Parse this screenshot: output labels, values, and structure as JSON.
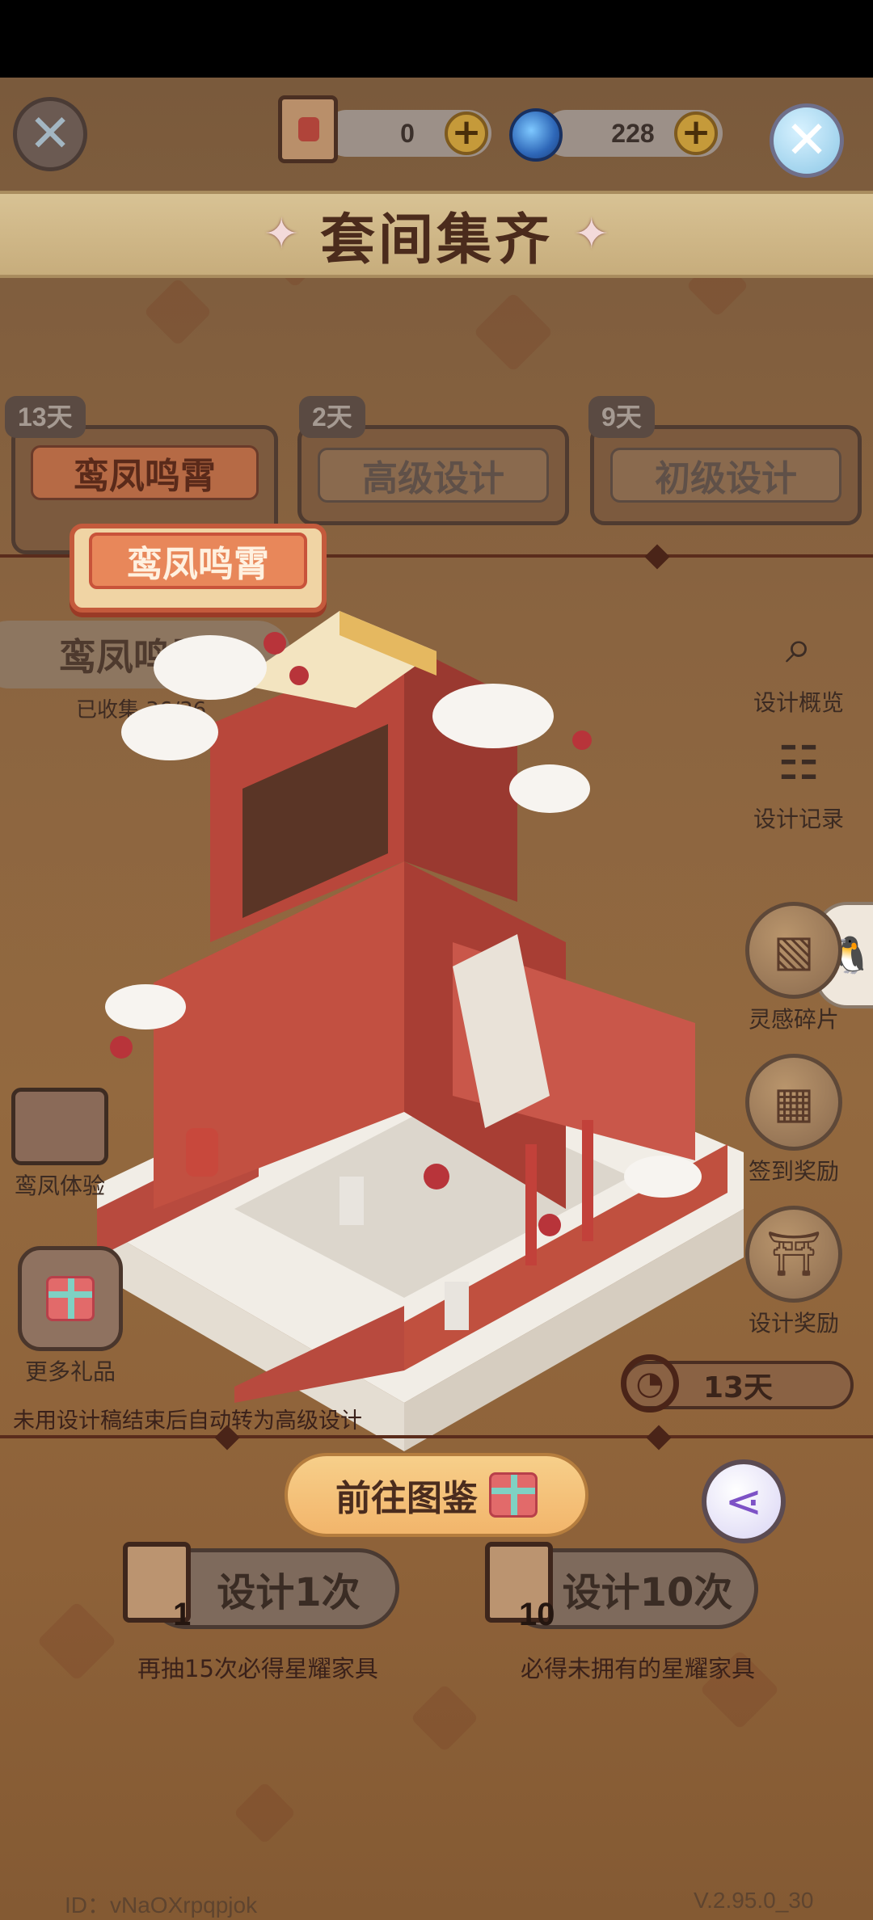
{
  "header": {
    "scroll_count": "0",
    "orb_count": "228",
    "banner_title": "套间集齐"
  },
  "tabs": [
    {
      "days": "13天",
      "label": "鸾凤鸣霄",
      "active": true
    },
    {
      "days": "2天",
      "label": "高级设计",
      "active": false
    },
    {
      "days": "9天",
      "label": "初级设计",
      "active": false
    }
  ],
  "set": {
    "card_label": "鸾凤鸣霄",
    "name": "鸾凤鸣霄",
    "collected": "已收集 36/36"
  },
  "side_menu": [
    {
      "label": "设计概览",
      "icon": "magnifier-icon"
    },
    {
      "label": "设计记录",
      "icon": "clipboard-icon"
    },
    {
      "label": "灵感碎片",
      "icon": "map-fragment-icon"
    },
    {
      "label": "签到奖励",
      "icon": "calendar-icon"
    },
    {
      "label": "设计奖励",
      "icon": "pagoda-icon"
    }
  ],
  "left_menu": [
    {
      "label": "鸾凤体验",
      "icon": "scroll-bundle-icon"
    },
    {
      "label": "更多礼品",
      "icon": "gift-icon"
    }
  ],
  "timer": "13天",
  "notice": "未用设计稿结束后自动转为高级设计",
  "gallery_button": "前往图鉴",
  "draws": [
    {
      "label": "设计1次",
      "count": "1",
      "hint": "再抽15次必得星耀家具"
    },
    {
      "label": "设计10次",
      "count": "10",
      "hint": "必得未拥有的星耀家具"
    }
  ],
  "footer": {
    "id": "ID：vNaOXrpqpjok",
    "version": "V.2.95.0_30"
  }
}
